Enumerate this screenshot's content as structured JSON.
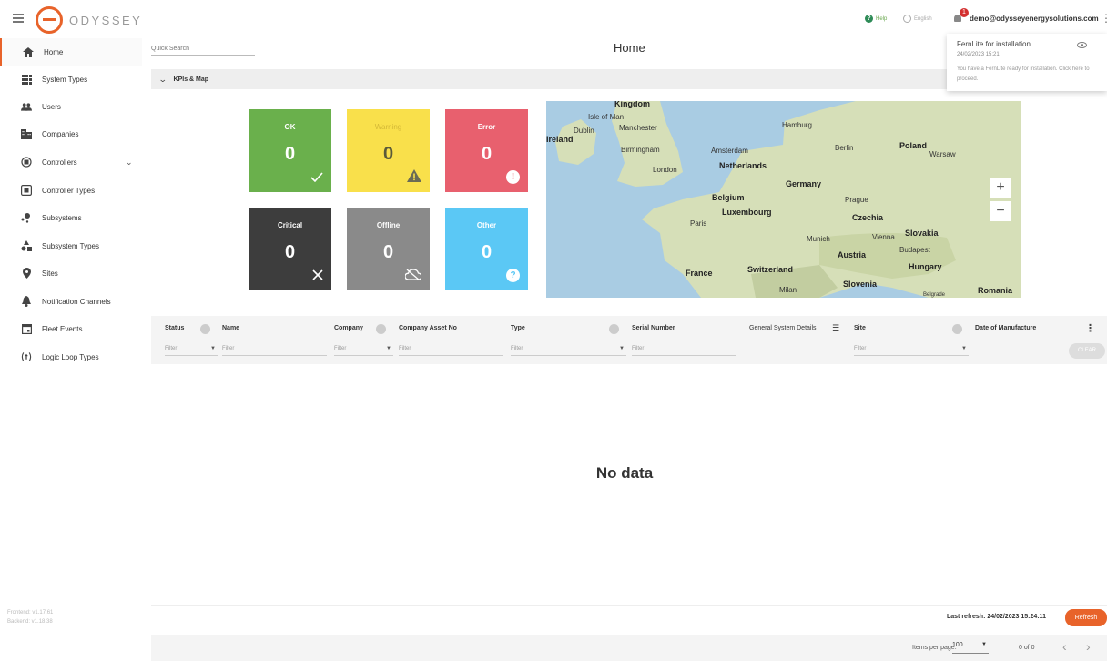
{
  "app": {
    "brand": "ODYSSEY"
  },
  "topbar": {
    "help_label": "Help",
    "language_label": "English",
    "notification_count": "1",
    "user_email": "demo@odysseyenergysolutions.com"
  },
  "notification": {
    "title": "FernLite for installation",
    "date": "24/02/2023 15:21",
    "body": "You have a FernLite ready for installation. Click here to proceed."
  },
  "sidebar": {
    "items": [
      {
        "label": "Home",
        "icon": "home-icon"
      },
      {
        "label": "System Types",
        "icon": "grid-icon"
      },
      {
        "label": "Users",
        "icon": "users-icon"
      },
      {
        "label": "Companies",
        "icon": "building-icon"
      },
      {
        "label": "Controllers",
        "icon": "controller-icon"
      },
      {
        "label": "Controller Types",
        "icon": "controller-types-icon"
      },
      {
        "label": "Subsystems",
        "icon": "subsystems-icon"
      },
      {
        "label": "Subsystem Types",
        "icon": "shapes-icon"
      },
      {
        "label": "Sites",
        "icon": "location-pin-icon"
      },
      {
        "label": "Notification Channels",
        "icon": "bell-icon"
      },
      {
        "label": "Fleet Events",
        "icon": "calendar-icon"
      },
      {
        "label": "Logic Loop Types",
        "icon": "logic-loop-icon"
      }
    ],
    "frontend_version": "Frontend: v1.17.61",
    "backend_version": "Backend: v1.18.38"
  },
  "search": {
    "placeholder": "Quick Search"
  },
  "page": {
    "title": "Home"
  },
  "kpi_section": {
    "label": "KPIs & Map"
  },
  "kpis": [
    {
      "title": "OK",
      "value": "0",
      "icon": "checkmark-icon",
      "color": "#6ab04c"
    },
    {
      "title": "Warning",
      "value": "0",
      "icon": "warning-icon",
      "color": "#f9e04b"
    },
    {
      "title": "Error",
      "value": "0",
      "icon": "error-icon",
      "color": "#e8606e"
    },
    {
      "title": "Critical",
      "value": "0",
      "icon": "close-icon",
      "color": "#3d3d3d"
    },
    {
      "title": "Offline",
      "value": "0",
      "icon": "cloud-off-icon",
      "color": "#8a8a8a"
    },
    {
      "title": "Other",
      "value": "0",
      "icon": "question-icon",
      "color": "#5bc8f5"
    }
  ],
  "map": {
    "labels": [
      "Kingdom",
      "Isle of Man",
      "Dublin",
      "Ireland",
      "Manchester",
      "Birmingham",
      "London",
      "Amsterdam",
      "Netherlands",
      "Hamburg",
      "Berlin",
      "Poland",
      "Warsaw",
      "Germany",
      "Belgium",
      "Luxembourg",
      "Prague",
      "Czechia",
      "Paris",
      "Munich",
      "Vienna",
      "Slovakia",
      "Budapest",
      "Austria",
      "Hungary",
      "France",
      "Switzerland",
      "Milan",
      "Slovenia",
      "Romania",
      "Belgrade"
    ],
    "zoom_in": "+",
    "zoom_out": "−"
  },
  "table": {
    "columns": [
      "Status",
      "Name",
      "Company",
      "Company Asset No",
      "Type",
      "Serial Number",
      "General System Details",
      "Site",
      "Date of Manufacture"
    ],
    "filter_placeholder": "Filter",
    "clear_label": "CLEAR",
    "empty_text": "No data"
  },
  "footer": {
    "last_refresh": "Last refresh: 24/02/2023 15:24:11",
    "refresh_label": "Refresh",
    "items_per_page_label": "Items per page:",
    "items_per_page_value": "100",
    "range": "0 of 0"
  },
  "colors": {
    "accent": "#e8632a",
    "map_water": "#a9cce3",
    "map_land": "#d6dfb8"
  }
}
